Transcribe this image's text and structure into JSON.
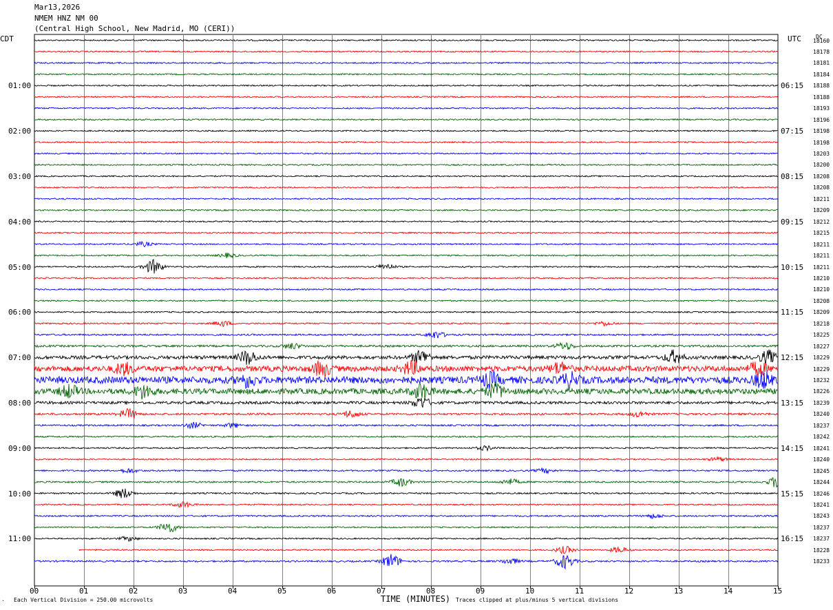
{
  "header": {
    "date": "Mar13,2026",
    "station": "NMEM HNZ NM 00",
    "location": "(Central High School, New Madrid, MO (CERI))"
  },
  "axes": {
    "left_label": "CDT",
    "right_label": "UTC",
    "dc_label": "DC",
    "xlabel": "TIME (MINUTES)"
  },
  "footer": {
    "scale_note": "Each Vertical Division = 250.00 microvolts",
    "clip_note": "Traces clipped at plus/minus 5 vertical divisions",
    "corner_mark": "."
  },
  "colors": {
    "trace_cycle": [
      "#000000",
      "#ff0000",
      "#0000ff",
      "#006400"
    ],
    "grid": "#808080"
  },
  "chart_data": {
    "type": "helicorder",
    "x_ticks": [
      "00",
      "01",
      "02",
      "03",
      "04",
      "05",
      "06",
      "07",
      "08",
      "09",
      "10",
      "11",
      "12",
      "13",
      "14",
      "15"
    ],
    "xlim": [
      0,
      15
    ],
    "minutes_per_line": 15,
    "left_time_labels": [
      "01:00",
      "02:00",
      "03:00",
      "04:00",
      "05:00",
      "06:00",
      "07:00",
      "08:00",
      "09:00",
      "10:00",
      "11:00"
    ],
    "right_time_labels": [
      "06:15",
      "07:15",
      "08:15",
      "09:15",
      "10:15",
      "11:15",
      "12:15",
      "13:15",
      "14:15",
      "15:15",
      "16:15"
    ],
    "dc_offsets": [
      18160,
      18178,
      18181,
      18184,
      18188,
      18188,
      18193,
      18196,
      18198,
      18198,
      18203,
      18200,
      18208,
      18208,
      18211,
      18209,
      18212,
      18215,
      18211,
      18211,
      18211,
      18210,
      18210,
      18208,
      18209,
      18218,
      18225,
      18227,
      18229,
      18229,
      18232,
      18226,
      18239,
      18240,
      18237,
      18242,
      18241,
      18240,
      18245,
      18244,
      18246,
      18241,
      18243,
      18237,
      18237,
      18228,
      18233
    ],
    "line_amplitudes": [
      1,
      1,
      1,
      1,
      1,
      1,
      1,
      1,
      1,
      1,
      1,
      1,
      1,
      1,
      1,
      1,
      1,
      1,
      1,
      1,
      1,
      1,
      1,
      1,
      1,
      1,
      1.2,
      1.5,
      2.5,
      4,
      5,
      4,
      2,
      1.4,
      1.2,
      1.1,
      1,
      1,
      1.1,
      1.2,
      1.1,
      1,
      1.1,
      1,
      1,
      1,
      1.2
    ],
    "events": [
      {
        "line": 18,
        "minute": 2.2,
        "amp": 3
      },
      {
        "line": 19,
        "minute": 3.9,
        "amp": 3
      },
      {
        "line": 20,
        "minute": 2.4,
        "amp": 10
      },
      {
        "line": 20,
        "minute": 7.1,
        "amp": 4
      },
      {
        "line": 25,
        "minute": 3.8,
        "amp": 4
      },
      {
        "line": 25,
        "minute": 11.5,
        "amp": 3
      },
      {
        "line": 26,
        "minute": 8.1,
        "amp": 5
      },
      {
        "line": 27,
        "minute": 5.2,
        "amp": 4
      },
      {
        "line": 27,
        "minute": 10.7,
        "amp": 5
      },
      {
        "line": 28,
        "minute": 4.3,
        "amp": 10
      },
      {
        "line": 28,
        "minute": 7.8,
        "amp": 10
      },
      {
        "line": 28,
        "minute": 12.9,
        "amp": 9
      },
      {
        "line": 28,
        "minute": 14.8,
        "amp": 9
      },
      {
        "line": 29,
        "minute": 1.8,
        "amp": 8
      },
      {
        "line": 29,
        "minute": 5.8,
        "amp": 10
      },
      {
        "line": 29,
        "minute": 7.6,
        "amp": 9
      },
      {
        "line": 29,
        "minute": 10.6,
        "amp": 8
      },
      {
        "line": 29,
        "minute": 14.6,
        "amp": 9
      },
      {
        "line": 30,
        "minute": 4.3,
        "amp": 8
      },
      {
        "line": 30,
        "minute": 9.2,
        "amp": 9
      },
      {
        "line": 30,
        "minute": 10.8,
        "amp": 9
      },
      {
        "line": 30,
        "minute": 14.7,
        "amp": 10
      },
      {
        "line": 31,
        "minute": 0.7,
        "amp": 8
      },
      {
        "line": 31,
        "minute": 2.2,
        "amp": 9
      },
      {
        "line": 31,
        "minute": 7.8,
        "amp": 10
      },
      {
        "line": 31,
        "minute": 9.3,
        "amp": 10
      },
      {
        "line": 32,
        "minute": 7.8,
        "amp": 8
      },
      {
        "line": 33,
        "minute": 1.9,
        "amp": 7
      },
      {
        "line": 33,
        "minute": 6.4,
        "amp": 5
      },
      {
        "line": 33,
        "minute": 12.2,
        "amp": 4
      },
      {
        "line": 34,
        "minute": 3.2,
        "amp": 4
      },
      {
        "line": 34,
        "minute": 4.0,
        "amp": 3
      },
      {
        "line": 36,
        "minute": 9.1,
        "amp": 3
      },
      {
        "line": 37,
        "minute": 13.8,
        "amp": 3
      },
      {
        "line": 38,
        "minute": 1.9,
        "amp": 3
      },
      {
        "line": 38,
        "minute": 10.3,
        "amp": 3
      },
      {
        "line": 39,
        "minute": 7.4,
        "amp": 6
      },
      {
        "line": 39,
        "minute": 9.6,
        "amp": 4
      },
      {
        "line": 39,
        "minute": 15.0,
        "amp": 9
      },
      {
        "line": 40,
        "minute": 1.8,
        "amp": 7
      },
      {
        "line": 41,
        "minute": 3.0,
        "amp": 4
      },
      {
        "line": 42,
        "minute": 12.5,
        "amp": 3
      },
      {
        "line": 43,
        "minute": 2.7,
        "amp": 8
      },
      {
        "line": 44,
        "minute": 1.9,
        "amp": 3
      },
      {
        "line": 45,
        "minute": 10.7,
        "amp": 5
      },
      {
        "line": 45,
        "minute": 11.8,
        "amp": 4
      },
      {
        "line": 46,
        "minute": 7.2,
        "amp": 10
      },
      {
        "line": 46,
        "minute": 10.7,
        "amp": 10
      },
      {
        "line": 46,
        "minute": 9.6,
        "amp": 4
      }
    ],
    "trace_starts": [
      {
        "line": 45,
        "minute": 0.9
      }
    ]
  }
}
